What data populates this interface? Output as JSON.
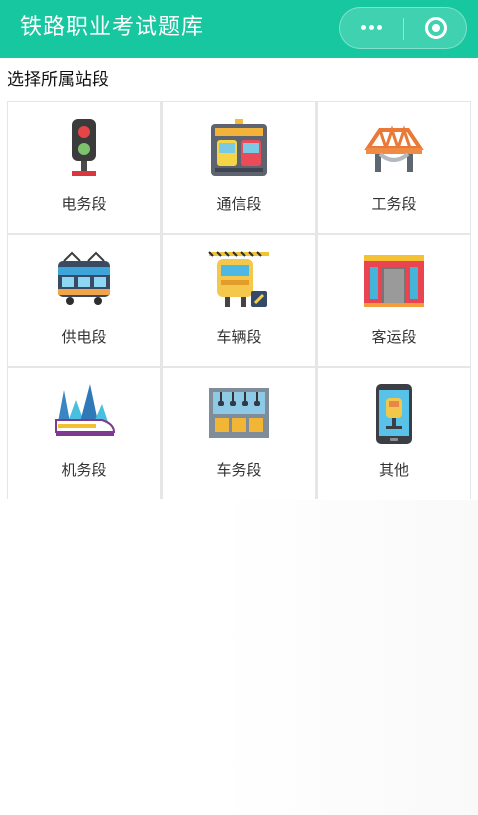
{
  "app": {
    "title": "铁路职业考试题库"
  },
  "capsule": {
    "more_icon": "more-dots-icon",
    "close_icon": "record-circle-icon"
  },
  "section": {
    "title": "选择所属站段"
  },
  "stations": [
    {
      "label": "电务段",
      "icon": "traffic-signal-icon"
    },
    {
      "label": "通信段",
      "icon": "communication-panel-icon"
    },
    {
      "label": "工务段",
      "icon": "bridge-icon"
    },
    {
      "label": "供电段",
      "icon": "electric-train-icon"
    },
    {
      "label": "车辆段",
      "icon": "rail-vehicle-icon"
    },
    {
      "label": "客运段",
      "icon": "passenger-station-icon"
    },
    {
      "label": "机务段",
      "icon": "locomotive-icon"
    },
    {
      "label": "车务段",
      "icon": "train-interior-icon"
    },
    {
      "label": "其他",
      "icon": "mobile-phone-icon"
    }
  ],
  "colors": {
    "header": "#16c7a0",
    "grid_line": "#e6e6e6",
    "text": "#333333"
  }
}
